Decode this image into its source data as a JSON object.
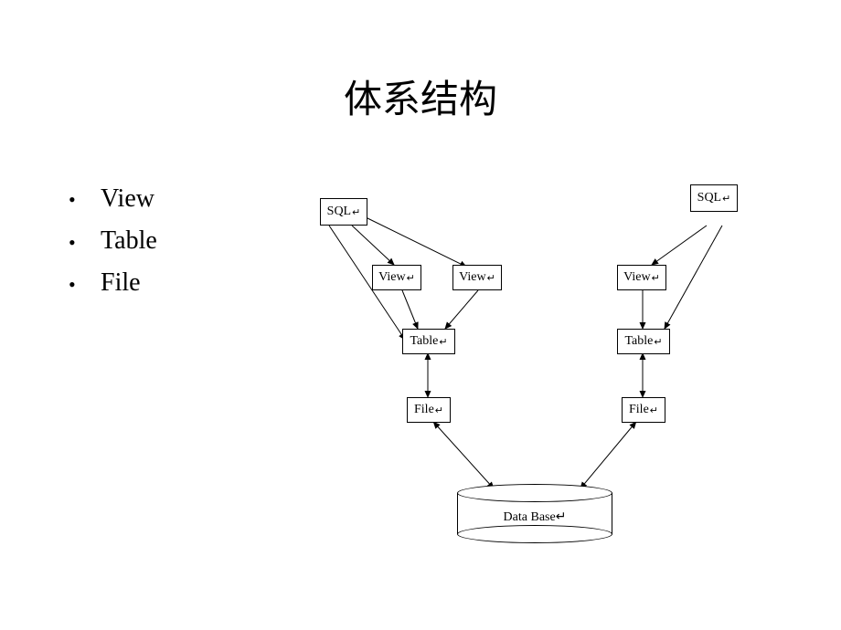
{
  "title": "体系结构",
  "bullets": [
    "View",
    "Table",
    "File"
  ],
  "nodes": {
    "sql_left": "SQL",
    "sql_right": "SQL",
    "view1": "View",
    "view2": "View",
    "view3": "View",
    "table1": "Table",
    "table2": "Table",
    "file1": "File",
    "file2": "File",
    "database": "Data Base"
  },
  "return_symbol": "↵",
  "diagram_edges": [
    {
      "from": "sql_left",
      "to": "view1",
      "bidir": false
    },
    {
      "from": "sql_left",
      "to": "view2",
      "bidir": false
    },
    {
      "from": "sql_left",
      "to": "table1",
      "bidir": false
    },
    {
      "from": "view1",
      "to": "table1",
      "bidir": false
    },
    {
      "from": "view2",
      "to": "table1",
      "bidir": false
    },
    {
      "from": "table1",
      "to": "file1",
      "bidir": true
    },
    {
      "from": "sql_right",
      "to": "view3",
      "bidir": false
    },
    {
      "from": "sql_right",
      "to": "table2",
      "bidir": false
    },
    {
      "from": "view3",
      "to": "table2",
      "bidir": false
    },
    {
      "from": "table2",
      "to": "file2",
      "bidir": true
    },
    {
      "from": "file1",
      "to": "database",
      "bidir": true
    },
    {
      "from": "file2",
      "to": "database",
      "bidir": true
    }
  ]
}
